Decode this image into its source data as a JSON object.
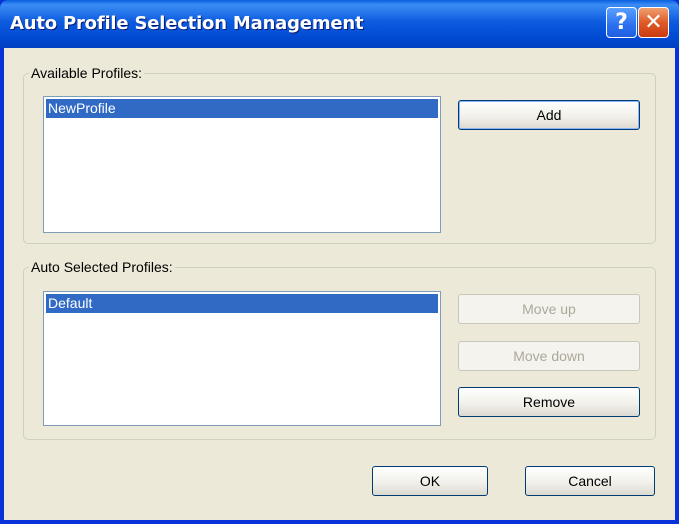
{
  "window": {
    "title": "Auto Profile Selection Management",
    "help_glyph": "?",
    "close_glyph": "✕"
  },
  "available": {
    "legend": "Available Profiles:",
    "items": [
      "NewProfile"
    ],
    "add_label": "Add"
  },
  "auto_selected": {
    "legend": "Auto Selected Profiles:",
    "items": [
      "Default"
    ],
    "move_up_label": "Move up",
    "move_down_label": "Move down",
    "remove_label": "Remove"
  },
  "footer": {
    "ok_label": "OK",
    "cancel_label": "Cancel"
  },
  "colors": {
    "title_bar": "#0054e3",
    "dialog_bg": "#ece9d8",
    "selection": "#316ac5"
  }
}
